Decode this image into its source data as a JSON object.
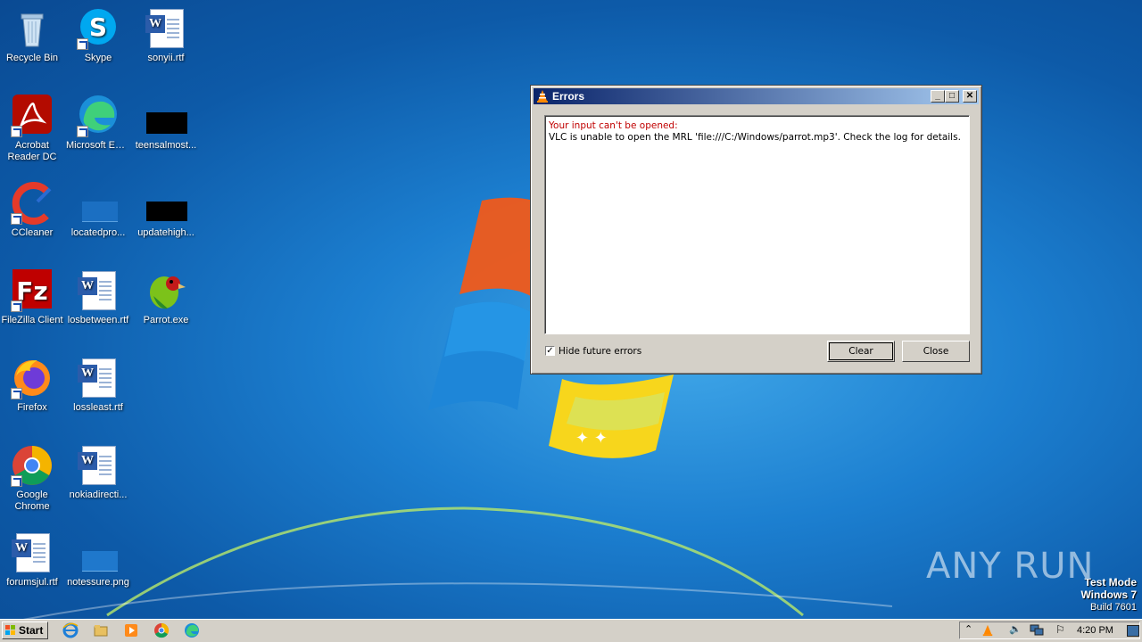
{
  "desktop": {
    "icons": [
      {
        "label": "Recycle Bin"
      },
      {
        "label": "Skype"
      },
      {
        "label": "sonyii.rtf"
      },
      {
        "label": "Acrobat Reader DC"
      },
      {
        "label": "Microsoft Edge"
      },
      {
        "label": "teensalmost..."
      },
      {
        "label": "CCleaner"
      },
      {
        "label": "locatedpro..."
      },
      {
        "label": "updatehigh..."
      },
      {
        "label": "FileZilla Client"
      },
      {
        "label": "losbetween.rtf"
      },
      {
        "label": "Parrot.exe"
      },
      {
        "label": "Firefox"
      },
      {
        "label": "lossleast.rtf"
      },
      {
        "label": "Google Chrome"
      },
      {
        "label": "nokiadirecti..."
      },
      {
        "label": "forumsjul.rtf"
      },
      {
        "label": "notessure.png"
      }
    ],
    "watermark": "ANY RUN",
    "test_mode": {
      "line1": "Test Mode",
      "line2": "Windows 7",
      "line3": "Build 7601"
    }
  },
  "dialog": {
    "title": "Errors",
    "error_heading": "Your input can't be opened:",
    "error_detail": "VLC is unable to open the MRL 'file:///C:/Windows/parrot.mp3'. Check the log for details.",
    "hide_future_errors_label": "Hide future errors",
    "hide_future_errors_checked": true,
    "clear_label": "Clear",
    "close_label": "Close",
    "minimize_glyph": "_",
    "maximize_glyph": "□",
    "close_glyph": "✕"
  },
  "taskbar": {
    "start_label": "Start",
    "clock": "4:20 PM",
    "pinned": [
      "ie-icon",
      "explorer-icon",
      "media-player-icon",
      "chrome-icon",
      "edge-icon"
    ],
    "tray": [
      "show-hidden-icon",
      "vlc-tray-icon",
      "volume-icon",
      "network-icon",
      "flag-icon",
      "desktop-icon"
    ]
  },
  "colors": {
    "error_text": "#c00000",
    "title_gradient_start": "#0a246a",
    "title_gradient_end": "#a6caf0",
    "desktop_blue": "#1c7fd0"
  }
}
